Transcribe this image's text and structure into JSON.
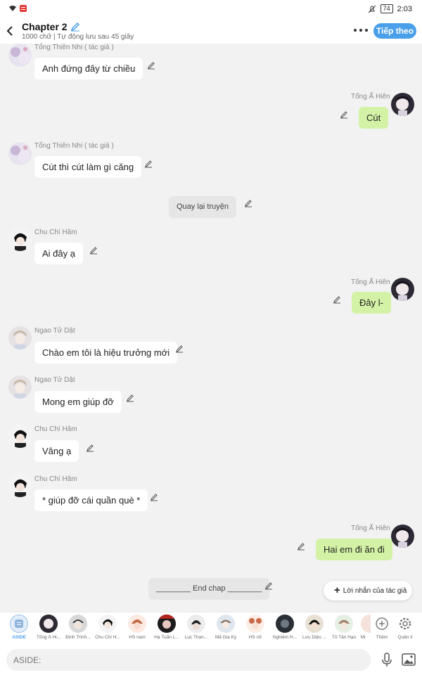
{
  "status": {
    "time": "2:03",
    "battery": "74"
  },
  "header": {
    "title": "Chapter 2",
    "subtitle": "1000 chữ | Tự động lưu sau 45 giây",
    "next_label": "Tiếp theo"
  },
  "messages": [
    {
      "name": "Tổng Thiên Nhi ( tác giả )",
      "text": "Anh đứng đây từ chiều"
    },
    {
      "name": "Tống Ấ Hiên",
      "text": "Cút"
    },
    {
      "name": "Tổng Thiên Nhi ( tác giả )",
      "text": "Cút thì cút làm gì căng"
    },
    {
      "name": "",
      "text": "Quay lại truyện"
    },
    {
      "name": "Chu Chí Hâm",
      "text": "Ai đây ạ"
    },
    {
      "name": "Tống Ấ Hiên",
      "text": "Đây l-"
    },
    {
      "name": "Ngao Tử Dật",
      "text": "Chào em tôi là hiệu trưởng mới"
    },
    {
      "name": "Ngao Tử Dật",
      "text": "Mong em giúp đỡ"
    },
    {
      "name": "Chu Chí Hâm",
      "text": "Vâng ạ"
    },
    {
      "name": "Chu Chí Hâm",
      "text": "* giúp đỡ cái quần què *"
    },
    {
      "name": "Tống Ấ Hiên",
      "text": "Hai em đi ăn đi"
    },
    {
      "name": "",
      "text": "________ End chap ________"
    }
  ],
  "author_note_label": "Lời nhắn của tác giả",
  "characters": [
    {
      "name": "ASIDE"
    },
    {
      "name": "Tống Ấ Hi..."
    },
    {
      "name": "Đinh Trình..."
    },
    {
      "name": "Chu Chí H..."
    },
    {
      "name": "HS nam"
    },
    {
      "name": "Hạ Tuấn L..."
    },
    {
      "name": "Lục Than..."
    },
    {
      "name": "Mã Gia Kỳ"
    },
    {
      "name": "HS nữ"
    },
    {
      "name": "Nghiêm H..."
    },
    {
      "name": "Lưu Diệu ..."
    },
    {
      "name": "Tô Tân Hạo"
    },
    {
      "name": "Mi"
    }
  ],
  "more_label": "Thêm",
  "manage_label": "Quản lí",
  "input_placeholder": "ASIDE:",
  "colors": {
    "accent": "#4a9fea",
    "own_bubble": "#d4f2a6",
    "background": "#f2f2f2"
  },
  "icons": [
    "back-icon",
    "pencil-icon",
    "more-icon",
    "edit-icon",
    "plus-icon",
    "settings-icon",
    "mic-icon",
    "image-icon"
  ]
}
